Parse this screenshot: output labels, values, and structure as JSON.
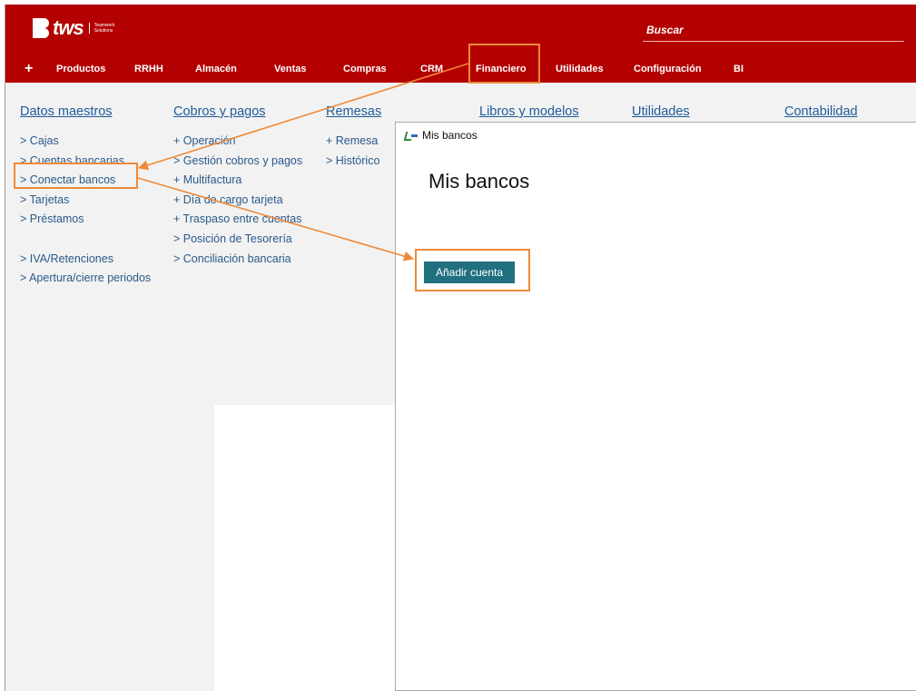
{
  "header": {
    "logo_text": "tws",
    "logo_subtext": "Teamwork Solutions",
    "search_placeholder": "Buscar",
    "nav": [
      {
        "label": "+"
      },
      {
        "label": "Productos"
      },
      {
        "label": "RRHH"
      },
      {
        "label": "Almacén"
      },
      {
        "label": "Ventas"
      },
      {
        "label": "Compras"
      },
      {
        "label": "CRM"
      },
      {
        "label": "Financiero"
      },
      {
        "label": "Utilidades"
      },
      {
        "label": "Configuración"
      },
      {
        "label": "BI"
      }
    ]
  },
  "menu": {
    "columns": [
      {
        "title": "Datos maestros",
        "items": [
          "> Cajas",
          "> Cuentas bancarias",
          "> Conectar bancos",
          "> Tarjetas",
          "> Préstamos",
          "",
          "> IVA/Retenciones",
          "> Apertura/cierre periodos"
        ]
      },
      {
        "title": "Cobros y pagos",
        "items": [
          "+ Operación",
          "> Gestión cobros y pagos",
          "+ Multifactura",
          "+ Día de cargo tarjeta",
          "+ Traspaso entre cuentas",
          "> Posición de Tesorería",
          "> Conciliación bancaria"
        ]
      },
      {
        "title": "Remesas",
        "items": [
          "+ Remesa",
          "> Histórico"
        ]
      },
      {
        "title": "Libros y modelos",
        "items": []
      },
      {
        "title": "Utilidades",
        "items": []
      },
      {
        "title": "Contabilidad",
        "items": []
      }
    ]
  },
  "dialog": {
    "window_title": "Mis bancos",
    "heading": "Mis bancos",
    "add_button": "Añadir cuenta"
  },
  "colors": {
    "brand_red": "#b30000",
    "link_blue": "#1f5b99",
    "button_teal": "#21707f",
    "annotation_orange": "#ee8a3a"
  }
}
